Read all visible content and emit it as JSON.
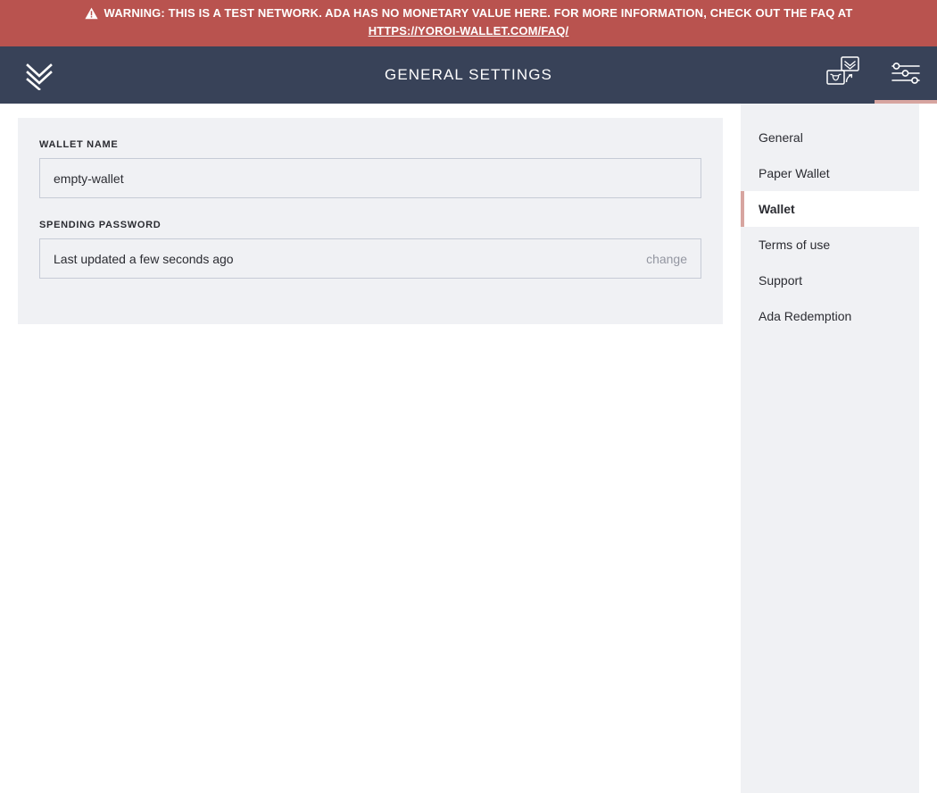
{
  "banner": {
    "icon": "warning-triangle-icon",
    "text": "WARNING: THIS IS A TEST NETWORK. ADA HAS NO MONETARY VALUE HERE. FOR MORE INFORMATION, CHECK OUT THE FAQ AT",
    "link_text": "HTTPS://YOROI-WALLET.COM/FAQ/",
    "background_color": "#b9534f",
    "text_color": "#ffffff"
  },
  "topbar": {
    "logo_icon": "yoroi-chevron-logo-icon",
    "title": "GENERAL SETTINGS",
    "background_color": "#384258",
    "actions": [
      {
        "icon": "wallet-switch-icon",
        "active": false
      },
      {
        "icon": "settings-sliders-icon",
        "active": true
      }
    ],
    "active_underline_color": "#d7a5a0"
  },
  "settings_form": {
    "wallet_name": {
      "label": "WALLET NAME",
      "value": "empty-wallet",
      "placeholder": "Wallet name"
    },
    "spending_password": {
      "label": "SPENDING PASSWORD",
      "status": "Last updated a few seconds ago",
      "change_label": "change"
    }
  },
  "settings_menu": {
    "items": [
      {
        "label": "General",
        "active": false
      },
      {
        "label": "Paper Wallet",
        "active": false
      },
      {
        "label": "Wallet",
        "active": true
      },
      {
        "label": "Terms of use",
        "active": false
      },
      {
        "label": "Support",
        "active": false
      },
      {
        "label": "Ada Redemption",
        "active": false
      }
    ],
    "active_indicator_color": "#d7a5a0",
    "background_color": "#f0f1f4"
  }
}
